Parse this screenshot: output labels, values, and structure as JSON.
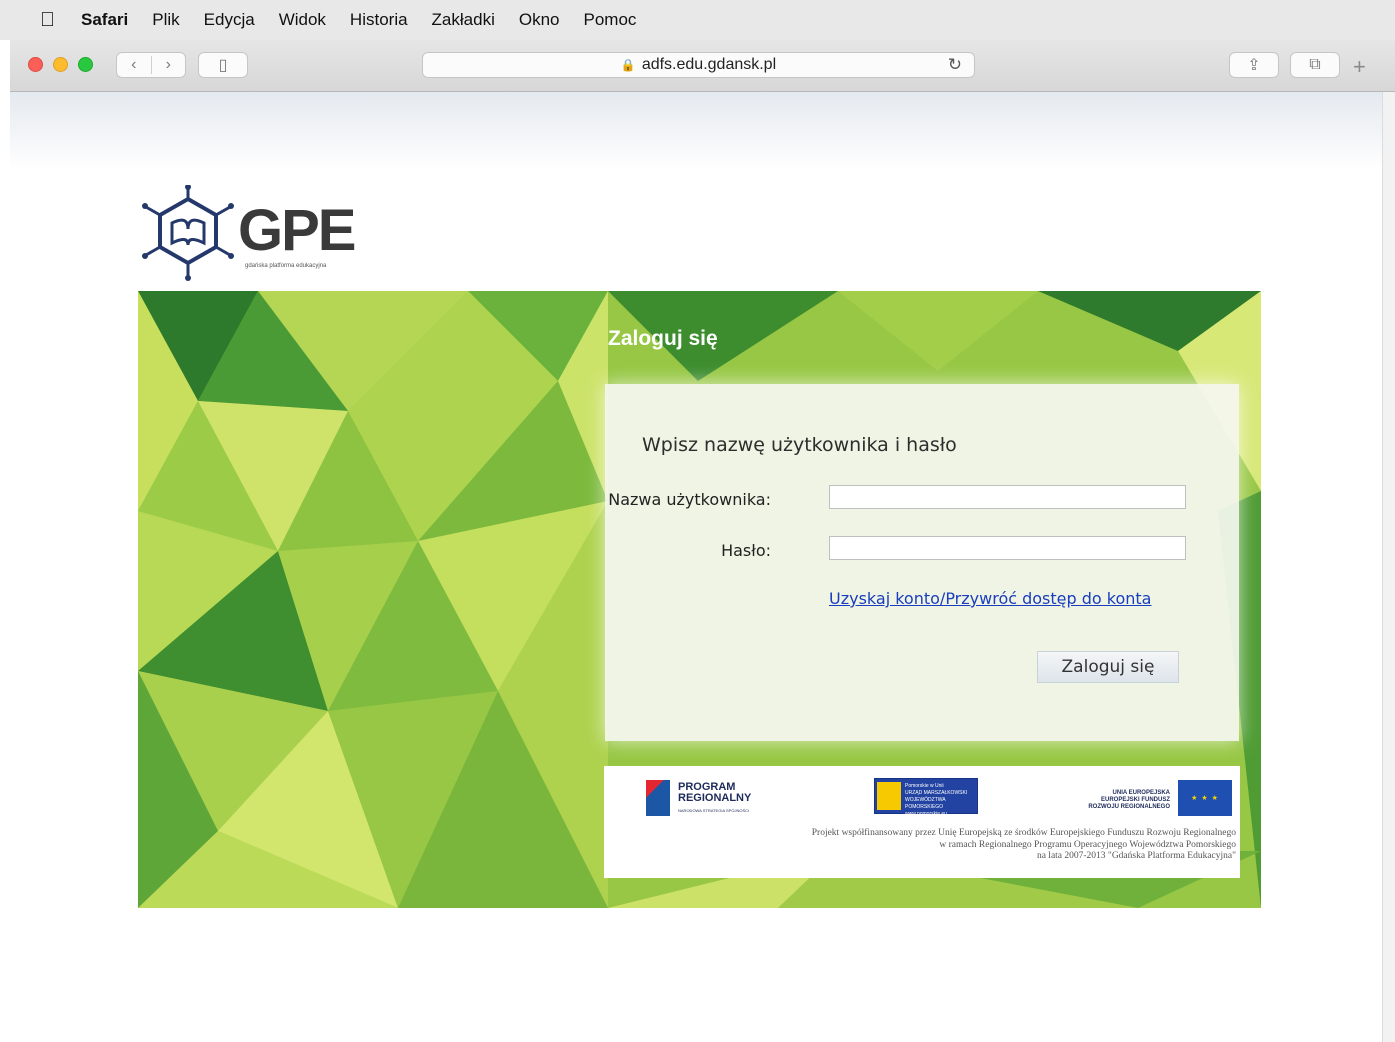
{
  "menubar": {
    "app": "Safari",
    "items": [
      "Plik",
      "Edycja",
      "Widok",
      "Historia",
      "Zakładki",
      "Okno",
      "Pomoc"
    ]
  },
  "toolbar": {
    "url": "adfs.edu.gdansk.pl",
    "back_icon": "‹",
    "forward_icon": "›",
    "sidebar_icon": "▯",
    "reload_icon": "↻",
    "share_icon": "⇪",
    "tabs_icon": "⧉",
    "plus_icon": "+"
  },
  "logo": {
    "name": "GPE",
    "tagline": "gdańska platforma edukacyjna"
  },
  "login": {
    "title": "Zaloguj się",
    "heading": "Wpisz nazwę użytkownika i hasło",
    "username_label": "Nazwa użytkownika:",
    "username_value": "",
    "password_label": "Hasło:",
    "password_value": "",
    "account_link": "Uzyskaj konto/Przywróć dostęp do konta",
    "submit_label": "Zaloguj się"
  },
  "funding": {
    "program_title_1": "PROGRAM",
    "program_title_2": "REGIONALNY",
    "program_sub": "NARODOWA STRATEGIA SPÓJNOŚCI",
    "pomorskie_line_1": "Pomorskie w Unii",
    "pomorskie_line_2": "URZĄD MARSZAŁKOWSKI",
    "pomorskie_line_3": "WOJEWÓDZTWA POMORSKIEGO",
    "pomorskie_line_4": "www.pomorskie.eu",
    "ue_line_1": "UNIA EUROPEJSKA",
    "ue_line_2": "EUROPEJSKI FUNDUSZ",
    "ue_line_3": "ROZWOJU REGIONALNEGO",
    "ue_stars": "★ ★ ★",
    "caption_1": "Projekt współfinansowany przez Unię Europejską ze środków Europejskiego Funduszu Rozwoju Regionalnego",
    "caption_2": "w ramach Regionalnego Programu Operacyjnego Województwa Pomorskiego",
    "caption_3": "na lata 2007-2013 \"Gdańska Platforma Edukacyjna\""
  },
  "colors": {
    "link": "#1a3dbd",
    "hero_green": "#8fc23f",
    "traffic_red": "#fc5f57",
    "traffic_yellow": "#fdbc2e",
    "traffic_green": "#29c840"
  }
}
